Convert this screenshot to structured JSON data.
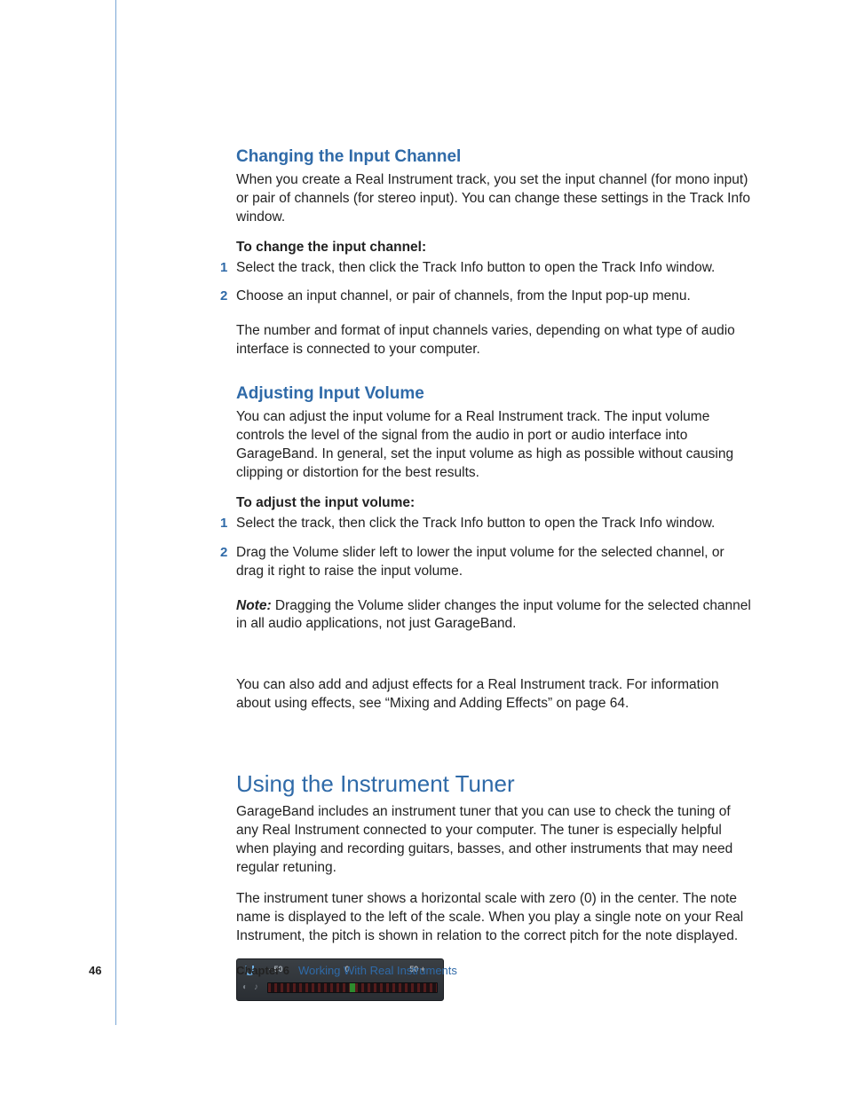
{
  "page_number": "46",
  "chapter_label": "Chapter 6",
  "chapter_title": "Working With Real Instruments",
  "s1": {
    "heading": "Changing the Input Channel",
    "p1": "When you create a Real Instrument track, you set the input channel (for mono input) or pair of channels (for stereo input). You can change these settings in the Track Info window.",
    "lead": "To change the input channel:",
    "steps": [
      "Select the track, then click the Track Info button to open the Track Info window.",
      "Choose an input channel, or pair of channels, from the Input pop-up menu."
    ],
    "p2": "The number and format of input channels varies, depending on what type of audio interface is connected to your computer."
  },
  "s2": {
    "heading": "Adjusting Input Volume",
    "p1": "You can adjust the input volume for a Real Instrument track. The input volume controls the level of the signal from the audio in port or audio interface into GarageBand. In general, set the input volume as high as possible without causing clipping or distortion for the best results.",
    "lead": "To adjust the input volume:",
    "steps": [
      "Select the track, then click the Track Info button to open the Track Info window.",
      "Drag the Volume slider left to lower the input volume for the selected channel, or drag it right to raise the input volume."
    ],
    "note_prefix": "Note:",
    "note_body": "  Dragging the Volume slider changes the input volume for the selected channel in all audio applications, not just GarageBand.",
    "p3": "You can also add and adjust effects for a Real Instrument track. For information about using effects, see “Mixing and Adding Effects” on page 64."
  },
  "s3": {
    "heading": "Using the Instrument Tuner",
    "p1": "GarageBand includes an instrument tuner that you can use to check the tuning of any Real Instrument connected to your computer. The tuner is especially helpful when playing and recording guitars, basses, and other instruments that may need regular retuning.",
    "p2": "The instrument tuner shows a horizontal scale with zero (0) in the center. The note name is displayed to the left of the scale. When you play a single note on your Real Instrument, the pitch is shown in relation to the correct pitch for the note displayed."
  },
  "tuner": {
    "left_label": "- 50",
    "center_label": "0",
    "right_label": "50 +"
  }
}
